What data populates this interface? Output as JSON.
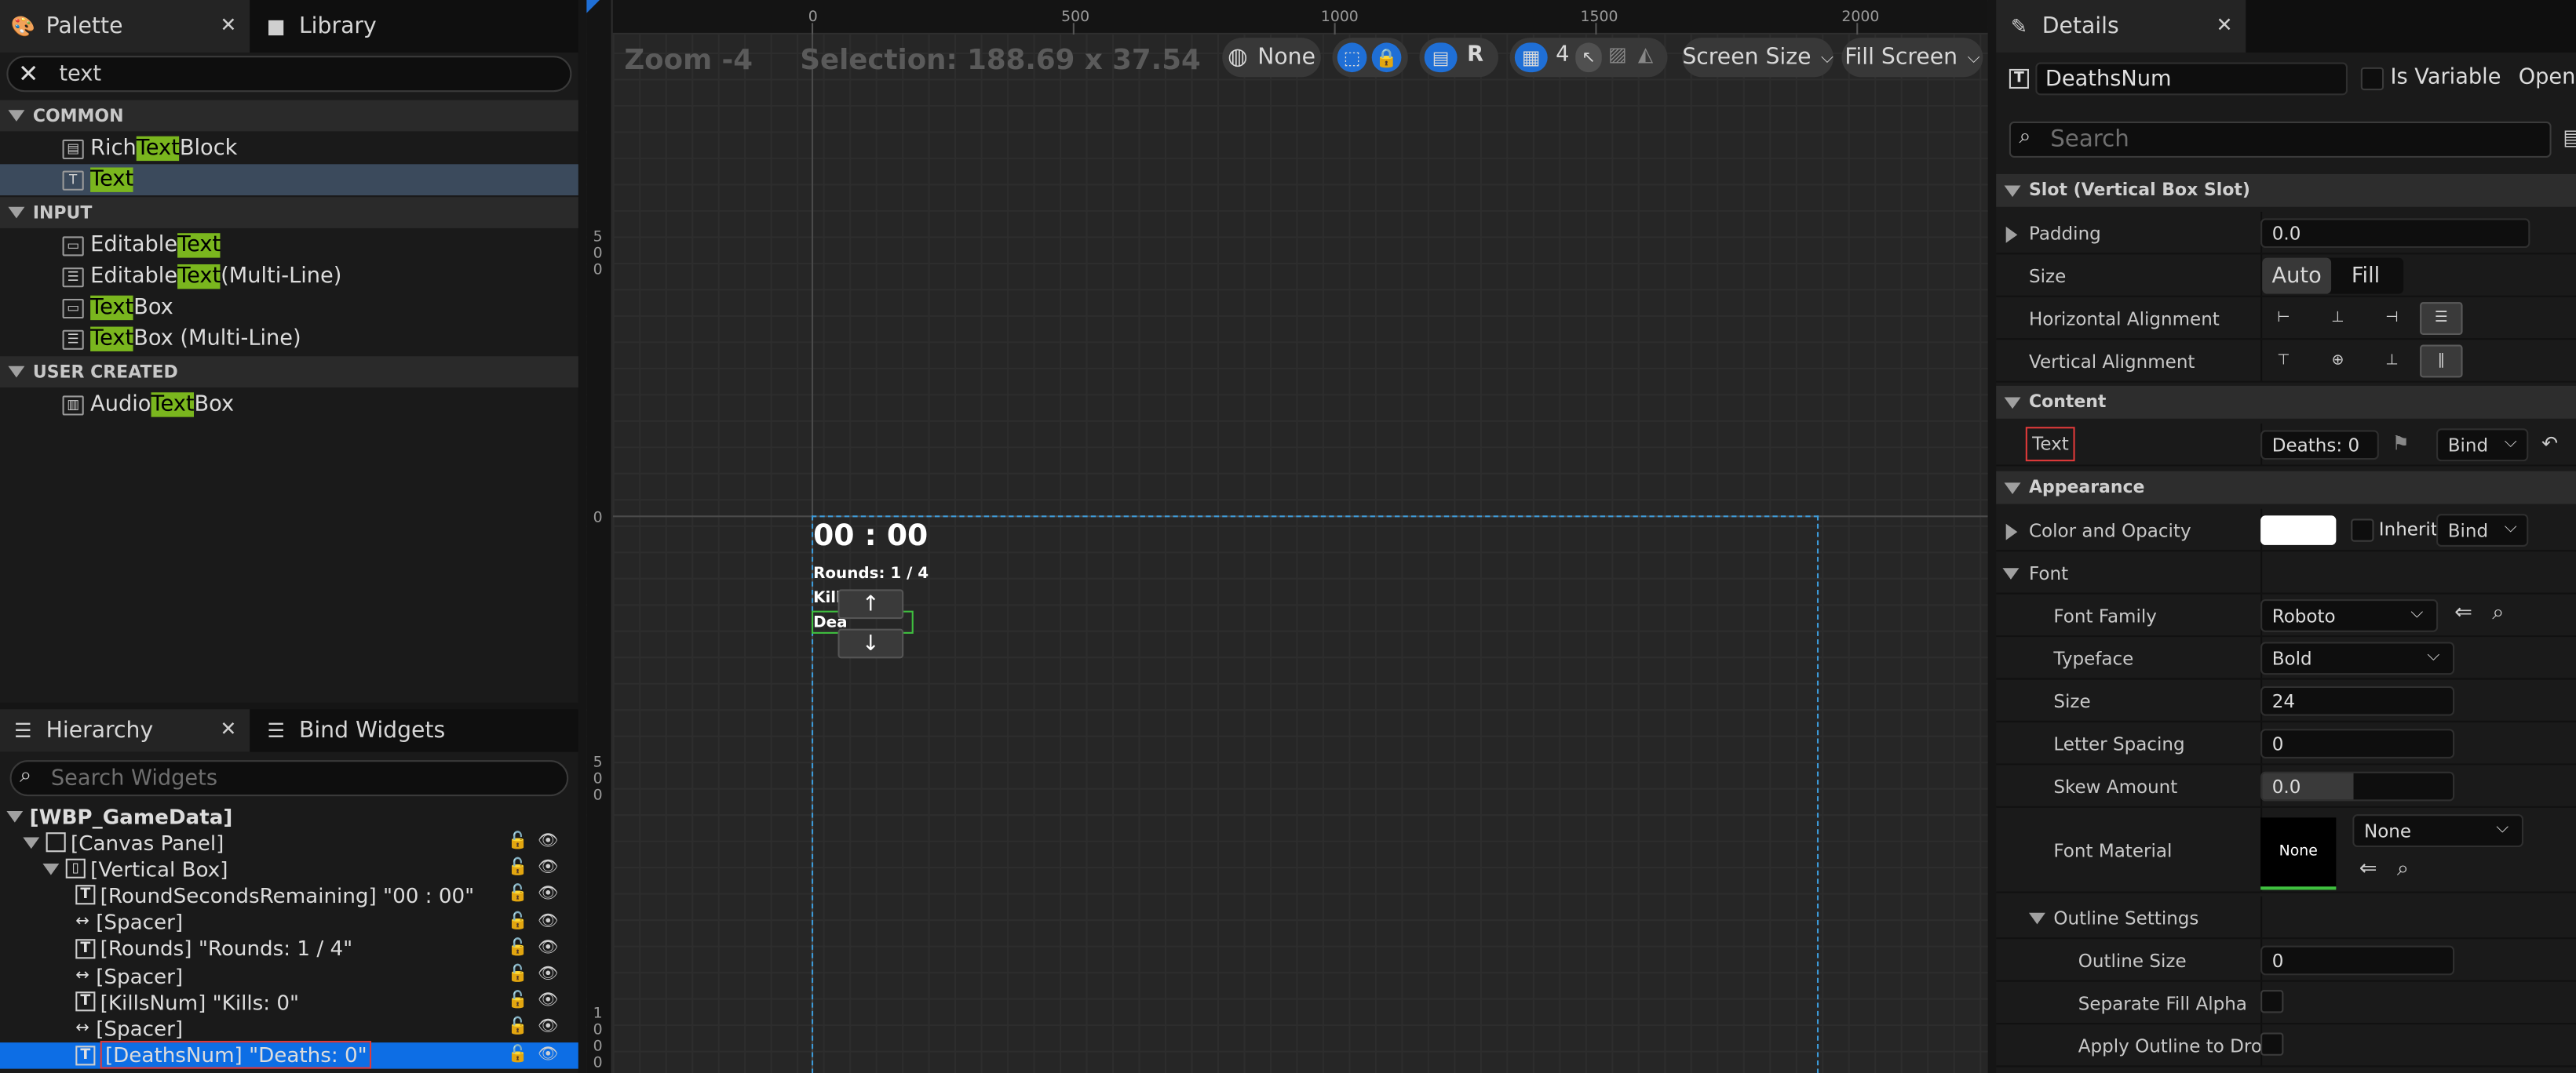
{
  "palette": {
    "tab_label": "Palette",
    "library_tab_label": "Library",
    "search_value": "text",
    "categories": [
      {
        "label": "COMMON",
        "items": [
          {
            "pre": "Rich ",
            "hl": "Text",
            "post": " Block"
          },
          {
            "pre": "",
            "hl": "Text",
            "post": ""
          }
        ]
      },
      {
        "label": "INPUT",
        "items": [
          {
            "pre": "Editable ",
            "hl": "Text",
            "post": ""
          },
          {
            "pre": "Editable ",
            "hl": "Text",
            "post": " (Multi-Line)"
          },
          {
            "pre": "",
            "hl": "Text",
            "post": " Box"
          },
          {
            "pre": "",
            "hl": "Text",
            "post": " Box (Multi-Line)"
          }
        ]
      },
      {
        "label": "USER CREATED",
        "items": [
          {
            "pre": "Audio ",
            "hl": "Text",
            "post": " Box"
          }
        ]
      }
    ]
  },
  "hierarchy": {
    "tab_label": "Hierarchy",
    "bind_tab_label": "Bind Widgets",
    "search_placeholder": "Search Widgets",
    "root_label": "[WBP_GameData]",
    "rows": [
      {
        "label": "[Canvas Panel]"
      },
      {
        "label": "[Vertical Box]"
      },
      {
        "label": "[RoundSecondsRemaining] \"00 : 00\""
      },
      {
        "label": "[Spacer]"
      },
      {
        "label": "[Rounds] \"Rounds: 1 / 4\""
      },
      {
        "label": "[Spacer]"
      },
      {
        "label": "[KillsNum] \"Kills: 0\""
      },
      {
        "label": "[Spacer]"
      },
      {
        "label": "[DeathsNum] \"Deaths: 0\""
      }
    ]
  },
  "viewport": {
    "zoom_label": "Zoom -4",
    "selection_label": "Selection: 188.69 x 37.54",
    "ruler_h": [
      "0",
      "500",
      "1000",
      "1500",
      "2000"
    ],
    "ruler_v": [
      "5\n0\n0",
      "0",
      "5\n0\n0",
      "1\n0\n0\n0"
    ],
    "toolbar": {
      "localization": "None",
      "r_label": "R",
      "grid_count": "4",
      "screen_size": "Screen Size",
      "fill_screen": "Fill Screen"
    },
    "canvas_text": {
      "timer": "00 : 00",
      "rounds": "Rounds: 1 / 4",
      "kills": "Kill",
      "deaths": "Dea",
      "arrow_up": "↑",
      "arrow_down": "↓"
    }
  },
  "details": {
    "tab_label": "Details",
    "widget_name": "DeathsNum",
    "is_variable_label": "Is Variable",
    "open_label": "Open T",
    "search_placeholder": "Search",
    "sections": {
      "slot": "Slot (Vertical Box Slot)",
      "content": "Content",
      "appearance": "Appearance",
      "font": "Font",
      "outline": "Outline Settings"
    },
    "props": {
      "padding_label": "Padding",
      "padding_value": "0.0",
      "size_label": "Size",
      "size_auto": "Auto",
      "size_fill": "Fill",
      "halign_label": "Horizontal Alignment",
      "valign_label": "Vertical Alignment",
      "text_label": "Text",
      "text_value": "Deaths: 0",
      "bind_label": "Bind",
      "color_label": "Color and Opacity",
      "inherit_label": "Inherit",
      "font_family_label": "Font Family",
      "font_family_value": "Roboto",
      "typeface_label": "Typeface",
      "typeface_value": "Bold",
      "font_size_label": "Size",
      "font_size_value": "24",
      "letter_spacing_label": "Letter Spacing",
      "letter_spacing_value": "0",
      "skew_label": "Skew Amount",
      "skew_value": "0.0",
      "font_material_label": "Font Material",
      "font_material_thumb": "None",
      "font_material_value": "None",
      "outline_size_label": "Outline Size",
      "outline_size_value": "0",
      "separate_fill_label": "Separate Fill Alpha",
      "apply_outline_label": "Apply Outline to Dro..."
    }
  },
  "colors": {
    "accent_blue": "#0d6ee5",
    "highlight_green": "#7ab61e",
    "selection_outline": "#e03a3a"
  }
}
